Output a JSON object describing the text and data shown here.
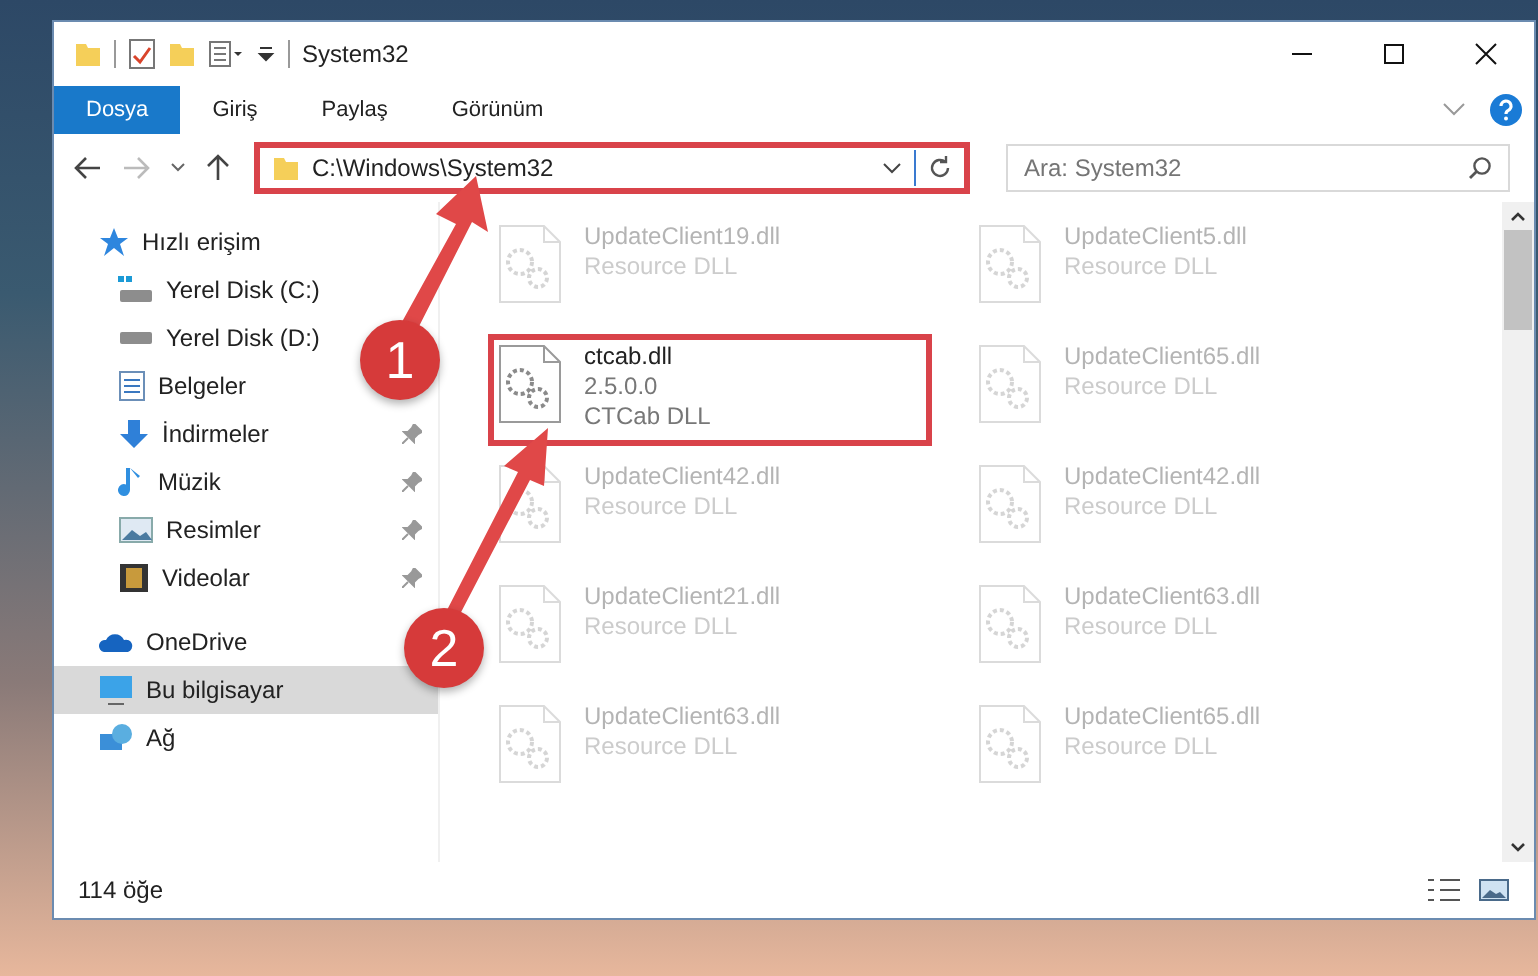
{
  "title_bar": {
    "title": "System32"
  },
  "ribbon_tabs": [
    {
      "label": "Dosya",
      "selected": true
    },
    {
      "label": "Giriş",
      "selected": false
    },
    {
      "label": "Paylaş",
      "selected": false
    },
    {
      "label": "Görünüm",
      "selected": false
    }
  ],
  "address_bar": {
    "path": "C:\\Windows\\System32",
    "highlighted": true
  },
  "search": {
    "placeholder": "Ara: System32"
  },
  "sidebar": {
    "items": [
      {
        "label": "Hızlı erişim",
        "kind": "star",
        "selected": false,
        "children": [
          {
            "label": "Yerel Disk (C:)",
            "kind": "drive-c",
            "pinned": false,
            "selected": false
          },
          {
            "label": "Yerel Disk (D:)",
            "kind": "drive",
            "pinned": false,
            "selected": false
          },
          {
            "label": "Belgeler",
            "kind": "document",
            "pinned": false,
            "selected": false
          },
          {
            "label": "İndirmeler",
            "kind": "download",
            "pinned": true,
            "selected": false
          },
          {
            "label": "Müzik",
            "kind": "music",
            "pinned": true,
            "selected": false
          },
          {
            "label": "Resimler",
            "kind": "picture",
            "pinned": true,
            "selected": false
          },
          {
            "label": "Videolar",
            "kind": "video",
            "pinned": true,
            "selected": false
          }
        ]
      },
      {
        "label": "OneDrive",
        "kind": "cloud",
        "selected": false
      },
      {
        "label": "Bu bilgisayar",
        "kind": "computer",
        "selected": true
      },
      {
        "label": "Ağ",
        "kind": "network",
        "selected": false
      }
    ]
  },
  "files": [
    {
      "name": "UpdateClient19.dll",
      "description": "Resource DLL",
      "blurred": true,
      "highlighted": false
    },
    {
      "name": "UpdateClient5.dll",
      "description": "Resource DLL",
      "blurred": true,
      "highlighted": false
    },
    {
      "name": "ctcab.dll",
      "version": "2.5.0.0",
      "description": "CTCab DLL",
      "blurred": false,
      "highlighted": true
    },
    {
      "name": "UpdateClient65.dll",
      "description": "Resource DLL",
      "blurred": true,
      "highlighted": false
    },
    {
      "name": "UpdateClient42.dll",
      "description": "Resource DLL",
      "blurred": true,
      "highlighted": false
    },
    {
      "name": "UpdateClient42.dll",
      "description": "Resource DLL",
      "blurred": true,
      "highlighted": false
    },
    {
      "name": "UpdateClient21.dll",
      "description": "Resource DLL",
      "blurred": true,
      "highlighted": false
    },
    {
      "name": "UpdateClient63.dll",
      "description": "Resource DLL",
      "blurred": true,
      "highlighted": false
    },
    {
      "name": "UpdateClient63.dll",
      "description": "Resource DLL",
      "blurred": true,
      "highlighted": false
    },
    {
      "name": "UpdateClient65.dll",
      "description": "Resource DLL",
      "blurred": true,
      "highlighted": false
    }
  ],
  "status_bar": {
    "item_count": "114 öğe"
  },
  "annotations": [
    {
      "number": "1"
    },
    {
      "number": "2"
    }
  ]
}
